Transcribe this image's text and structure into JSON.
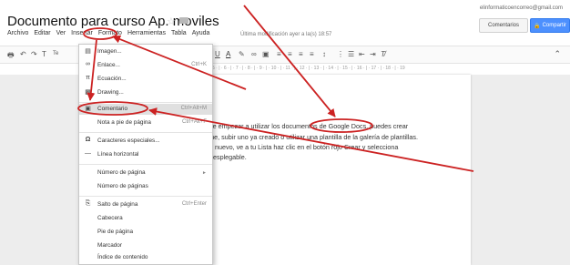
{
  "header": {
    "title": "Documento para curso Ap. moviles",
    "email": "elinformaticoencorreo@gmail.com",
    "comments_button": "Comentarios",
    "share_button": "Compartir",
    "last_modified": "Última modificación ayer a la(s) 18:57"
  },
  "menubar": [
    "Archivo",
    "Editar",
    "Ver",
    "Insertar",
    "Formato",
    "Herramientas",
    "Tabla",
    "Ayuda"
  ],
  "toolbar": {
    "font_abbrev": "Te"
  },
  "ruler": "4 · | · 5 · | · 6 · | · 7 · | · 8 · | · 9 · | · 10 · | · 11 · | · 12 · | · 13 · | · 14 · | · 15 · | · 16 · | · 17 · | · 18 · | · 19",
  "insert_menu": {
    "items": [
      {
        "label": "Imagen...",
        "shortcut": "",
        "icon": "image-icon"
      },
      {
        "label": "Enlace...",
        "shortcut": "Ctrl+K",
        "icon": "link-icon"
      },
      {
        "label": "Ecuación...",
        "shortcut": "",
        "icon": "equation-icon"
      },
      {
        "label": "Drawing...",
        "shortcut": "",
        "icon": "drawing-icon"
      },
      {
        "label": "Comentario",
        "shortcut": "Ctrl+Alt+M",
        "icon": "comment-icon"
      },
      {
        "label": "Nota a pie de página",
        "shortcut": "Ctrl+Alt+F",
        "icon": ""
      },
      {
        "label": "Caracteres especiales...",
        "shortcut": "",
        "icon": "omega-icon"
      },
      {
        "label": "Línea horizontal",
        "shortcut": "",
        "icon": "hr-icon"
      },
      {
        "label": "Número de página",
        "shortcut": "►",
        "icon": ""
      },
      {
        "label": "Número de páginas",
        "shortcut": "",
        "icon": ""
      },
      {
        "label": "Salto de página",
        "shortcut": "Ctrl+Enter",
        "icon": "pagebreak-icon"
      },
      {
        "label": "Cabecera",
        "shortcut": "",
        "icon": ""
      },
      {
        "label": "Pie de página",
        "shortcut": "",
        "icon": ""
      },
      {
        "label": "Marcador",
        "shortcut": "",
        "icon": ""
      },
      {
        "label": "Índice de contenido",
        "shortcut": "",
        "icon": ""
      }
    ]
  },
  "document": {
    "lines": [
      "os de empezar a utilizar los documentos de Google Docs, puedes crear",
      "online, subir uno ya creado o utilizar una plantilla de la galería de plantillas.",
      "ento nuevo, ve a tu Lista  haz clic en el botón rojo  Crear y selecciona",
      "nú desplegable."
    ]
  },
  "colors": {
    "annotation": "#cc2222",
    "share": "#4d90fe",
    "highlight": "#e0e0e0"
  }
}
